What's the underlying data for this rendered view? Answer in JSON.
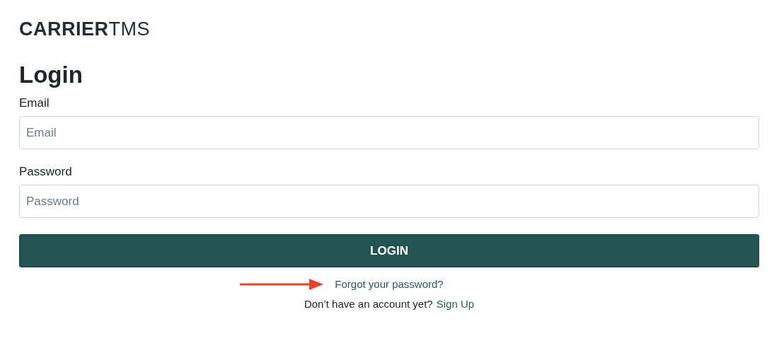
{
  "logo": "**CARRIER**TMS",
  "title": "Login",
  "fields": [
    {
      "label": "Email",
      "placeholder": "Email"
    },
    {
      "label": "Password",
      "placeholder": "Password"
    }
  ],
  "submit": "LOGIN",
  "forgot_link": {
    "text": "Forgot your password?",
    "highlighted": true
  },
  "signup": {
    "prompt": "Don’t have an account yet?",
    "link": "Sign Up"
  }
}
